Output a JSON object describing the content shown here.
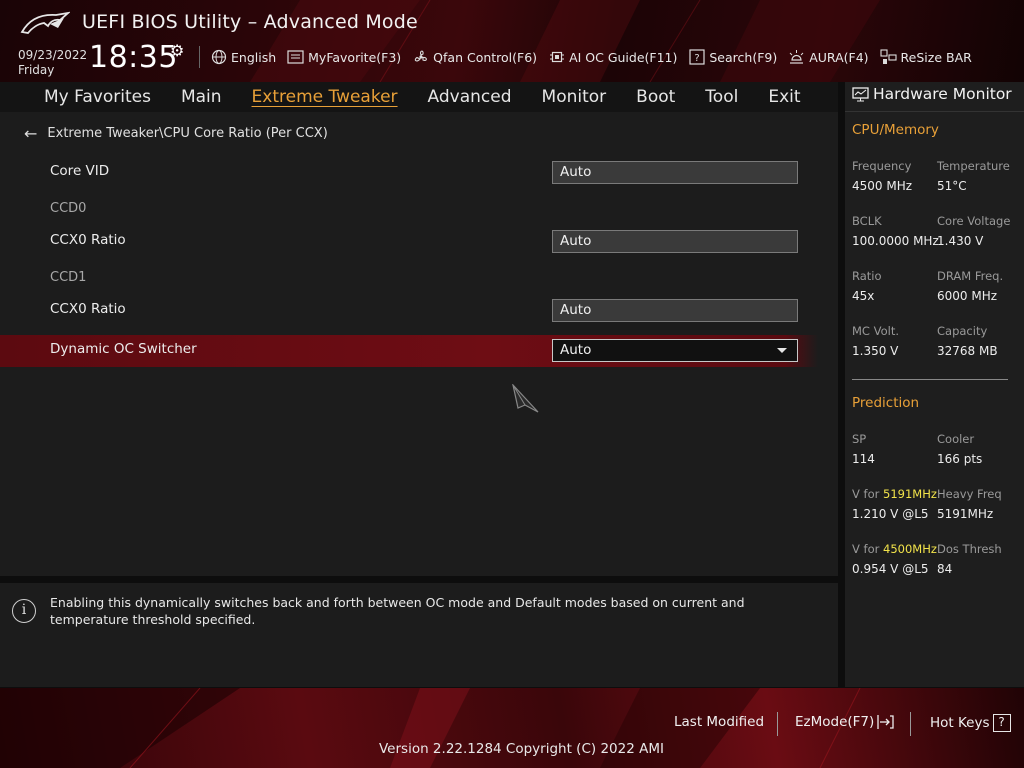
{
  "header": {
    "title": "UEFI BIOS Utility – Advanced Mode",
    "date": "09/23/2022",
    "day": "Friday",
    "time": "18:35",
    "toolbar": [
      {
        "label": "English",
        "icon": "globe-icon"
      },
      {
        "label": "MyFavorite(F3)",
        "icon": "favorite-list-icon"
      },
      {
        "label": "Qfan Control(F6)",
        "icon": "fan-icon"
      },
      {
        "label": "AI OC Guide(F11)",
        "icon": "chip-icon"
      },
      {
        "label": "Search(F9)",
        "icon": "question-box-icon"
      },
      {
        "label": "AURA(F4)",
        "icon": "light-icon"
      },
      {
        "label": "ReSize BAR",
        "icon": "resize-bar-icon"
      }
    ]
  },
  "nav": {
    "tabs": [
      "My Favorites",
      "Main",
      "Extreme Tweaker",
      "Advanced",
      "Monitor",
      "Boot",
      "Tool",
      "Exit"
    ],
    "active": "Extreme Tweaker"
  },
  "main": {
    "breadcrumb": "Extreme Tweaker\\CPU Core Ratio (Per CCX)",
    "rows": [
      {
        "label": "Core VID",
        "value": "Auto"
      },
      {
        "group": "CCD0"
      },
      {
        "label": "CCX0 Ratio",
        "value": "Auto"
      },
      {
        "group": "CCD1"
      },
      {
        "label": "CCX0 Ratio",
        "value": "Auto"
      },
      {
        "label": "Dynamic OC Switcher",
        "value": "Auto",
        "selected": true
      }
    ]
  },
  "help": {
    "text": "Enabling this dynamically switches back and forth between OC mode and Default modes based on current and temperature threshold specified."
  },
  "hardware_monitor": {
    "title": "Hardware Monitor",
    "cpu_memory": {
      "title": "CPU/Memory",
      "items": [
        {
          "key": "Frequency",
          "value": "4500 MHz"
        },
        {
          "key": "Temperature",
          "value": "51°C"
        },
        {
          "key": "BCLK",
          "value": "100.0000 MHz"
        },
        {
          "key": "Core Voltage",
          "value": "1.430 V"
        },
        {
          "key": "Ratio",
          "value": "45x"
        },
        {
          "key": "DRAM Freq.",
          "value": "6000 MHz"
        },
        {
          "key": "MC Volt.",
          "value": "1.350 V"
        },
        {
          "key": "Capacity",
          "value": "32768 MB"
        }
      ]
    },
    "prediction": {
      "title": "Prediction",
      "sp_key": "SP",
      "sp_value": "114",
      "cooler_key": "Cooler",
      "cooler_value": "166 pts",
      "v1_prefix": "V for ",
      "v1_freq": "5191MHz",
      "v1_value": "1.210 V @L5",
      "heavy_key": "Heavy Freq",
      "heavy_value": "5191MHz",
      "v2_prefix": "V for ",
      "v2_freq": "4500MHz",
      "v2_value": "0.954 V @L5",
      "dos_key": "Dos Thresh",
      "dos_value": "84"
    }
  },
  "footer": {
    "last_modified": "Last Modified",
    "ezmode": "EzMode(F7)",
    "hotkeys": "Hot Keys",
    "hotkeys_box": "?",
    "version": "Version 2.22.1284 Copyright (C) 2022 AMI"
  },
  "colors": {
    "accent": "#e8a038",
    "selection": "#6e0d14",
    "highlight_freq": "#f2e34a"
  }
}
